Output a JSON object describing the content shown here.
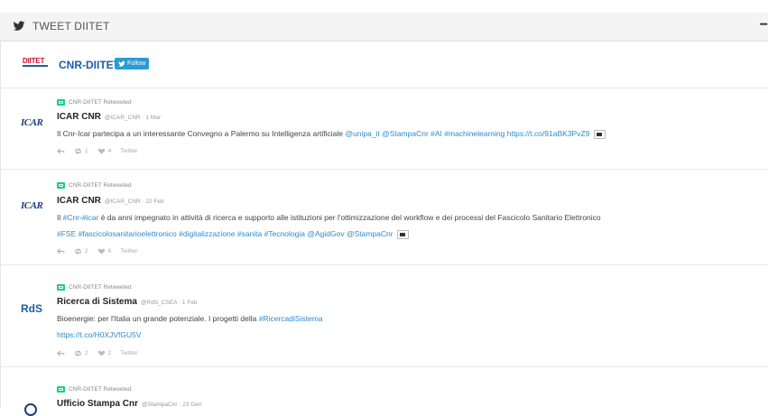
{
  "widget": {
    "header_title": "TWEET DIITET",
    "collapse_symbol": "−"
  },
  "timeline": {
    "account_logo_text": "DIITET",
    "account_name": "CNR-DIITET",
    "follow_label": "Follow"
  },
  "tweets": [
    {
      "retweeted_by": "CNR-DIITET Retweeted",
      "avatar_text": "ICAR",
      "name": "ICAR CNR",
      "meta": "@ICAR_CNR · 1 Mar",
      "text_plain": "Il Cnr-Icar partecipa a un interessante Convegno a Palermo su Intelligenza artificiale",
      "text_links": "@unipa_it @StampaCnr #AI #machinelearning https://t.co/91aBK3PvZ9",
      "reply": "",
      "retweets": "1",
      "likes": "4",
      "source": "Twitter"
    },
    {
      "retweeted_by": "CNR-DIITET Retweeted",
      "avatar_text": "ICAR",
      "name": "ICAR CNR",
      "meta": "@ICAR_CNR · 22 Feb",
      "line1_a": "Il",
      "line1_link": "#Cnr",
      "line1_b": "-",
      "line1_link2": "#icar",
      "line1_c": "è da anni impegnato in attività di ricerca e supporto alle istituzioni per l'ottimizzazione del workflow e dei processi del Fascicolo Sanitario Elettronico",
      "line2_links": "#FSE #fascicolosanitarioelettronico #digitalizzazione #sanita #Tecnologia @AgidGov @StampaCnr",
      "retweets": "2",
      "likes": "6",
      "source": "Twitter"
    },
    {
      "retweeted_by": "CNR-DIITET Retweeted",
      "avatar_text": "RdS",
      "name": "Ricerca di Sistema",
      "meta": "@RdS_CSEA · 1 Feb",
      "line1_plain": "Bioenergie: per l'Italia un grande potenziale. I progetti della",
      "line1_link": "#RicercadiSistema",
      "line2_link": "https://t.co/H0XJVfGU5V",
      "retweets": "2",
      "likes": "2",
      "source": "Twitter"
    },
    {
      "retweeted_by": "CNR-DIITET Retweeted",
      "name": "Ufficio Stampa Cnr",
      "meta": "@StampaCnr · 23 Gen"
    }
  ],
  "colors": {
    "link": "#2b8ccb",
    "brand_blue": "#1a5ea8",
    "retweet_green": "#19cf86",
    "follow_button": "#2b9bd3"
  }
}
